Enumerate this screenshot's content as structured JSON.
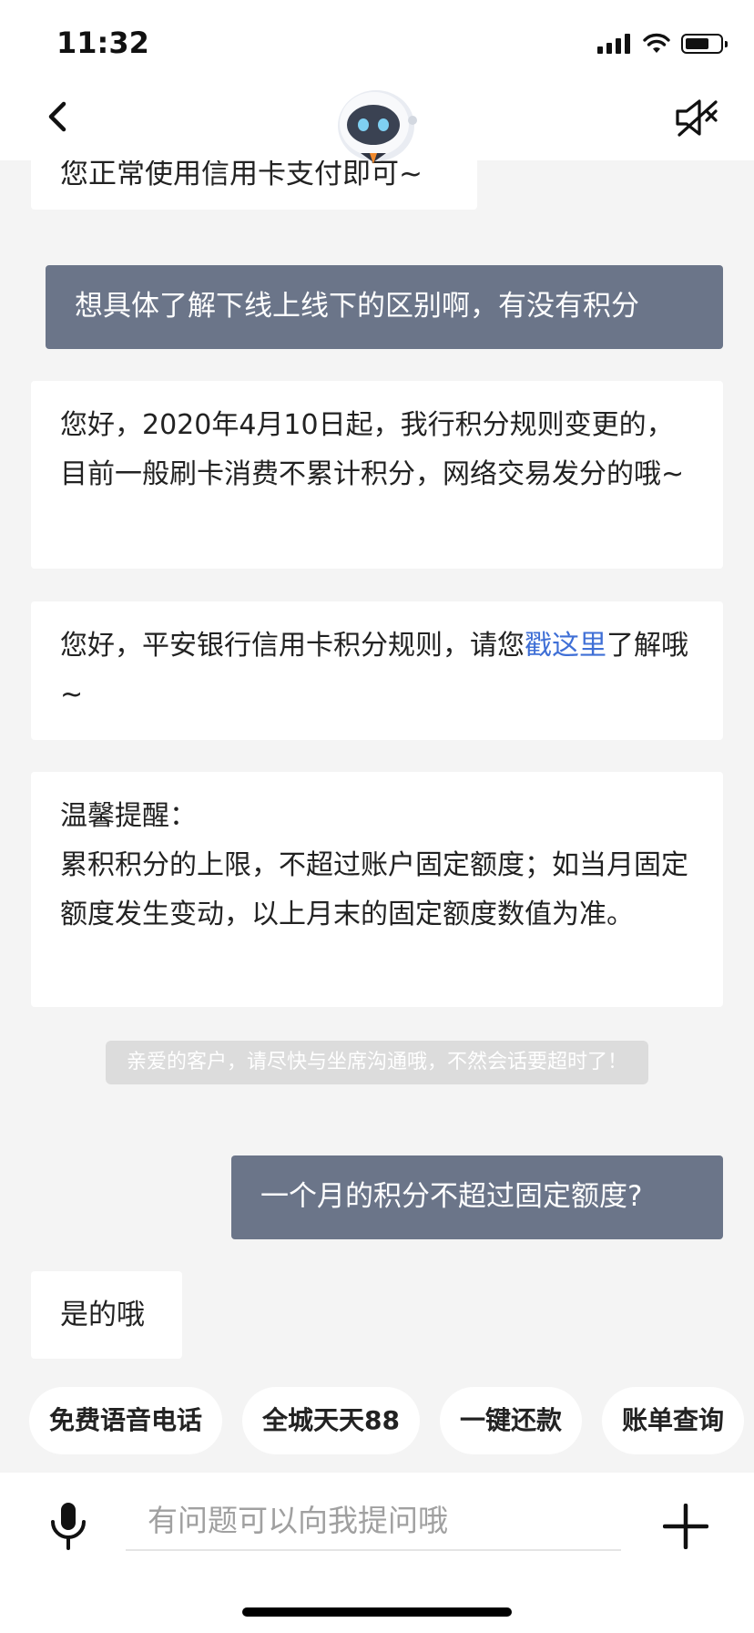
{
  "status_bar": {
    "time": "11:32"
  },
  "header": {
    "back_icon": "chevron-left-icon",
    "avatar": "robot-assistant-avatar",
    "mute_icon": "speaker-muted-icon"
  },
  "messages": [
    {
      "role": "bot",
      "text": "您正常使用信用卡支付即可~"
    },
    {
      "role": "user",
      "text": "想具体了解下线上线下的区别啊，有没有积分"
    },
    {
      "role": "bot",
      "text": "您好，2020年4月10日起，我行积分规则变更的，目前一般刷卡消费不累计积分，网络交易发分的哦~"
    },
    {
      "role": "bot",
      "text_before": "您好，平安银行信用卡积分规则，请您",
      "link": "戳这里",
      "text_after": "了解哦 ~"
    },
    {
      "role": "bot",
      "title": "温馨提醒：",
      "text": "累积积分的上限，不超过账户固定额度；如当月固定额度发生变动，以上月末的固定额度数值为准。"
    },
    {
      "role": "system",
      "text": "亲爱的客户，请尽快与坐席沟通哦，不然会话要超时了！"
    },
    {
      "role": "user",
      "text": "一个月的积分不超过固定额度?"
    },
    {
      "role": "bot",
      "text": "是的哦"
    }
  ],
  "quick_replies": [
    "免费语音电话",
    "全城天天88",
    "一键还款",
    "账单查询"
  ],
  "input": {
    "placeholder": "有问题可以向我提问哦",
    "mic_icon": "microphone-icon",
    "plus_icon": "plus-icon"
  },
  "colors": {
    "user_bubble": "#6b7589",
    "link": "#3f6fd6",
    "background": "#f4f4f4"
  }
}
